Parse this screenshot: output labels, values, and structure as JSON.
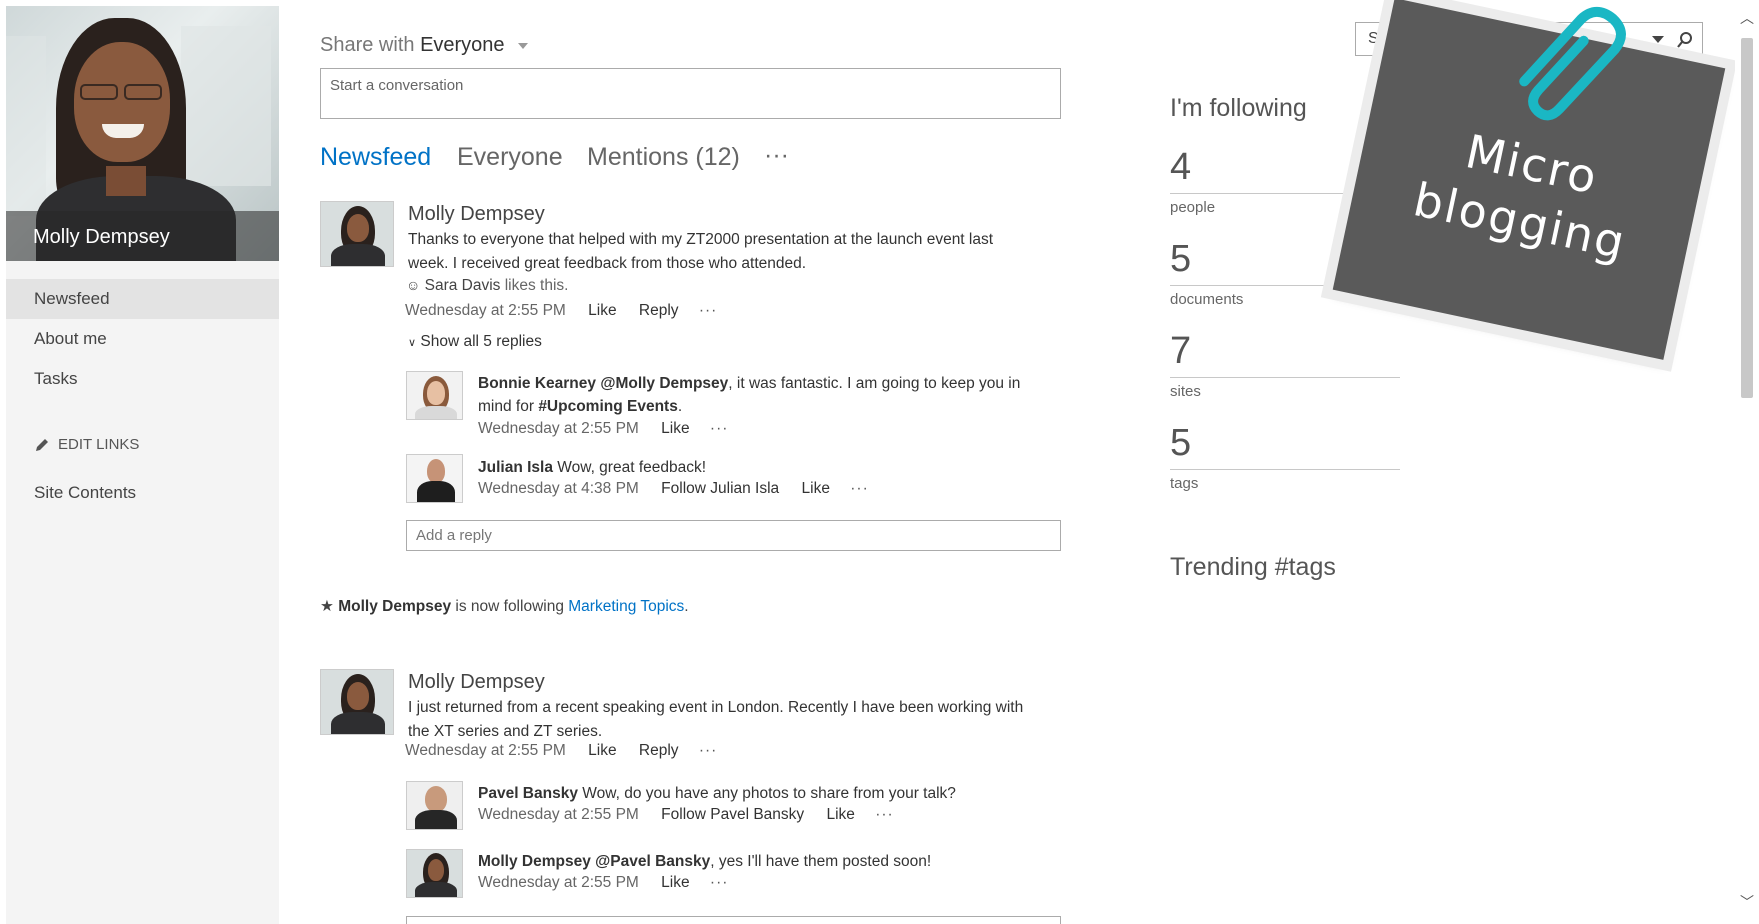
{
  "profile": {
    "name": "Molly Dempsey"
  },
  "nav": {
    "items": [
      {
        "label": "Newsfeed"
      },
      {
        "label": "About me"
      },
      {
        "label": "Tasks"
      }
    ],
    "edit_links": "EDIT LINKS",
    "site_contents": "Site Contents"
  },
  "share": {
    "prefix": "Share with",
    "audience": "Everyone",
    "placeholder": "Start a conversation"
  },
  "tabs": [
    {
      "label": "Newsfeed"
    },
    {
      "label": "Everyone"
    },
    {
      "label": "Mentions (12)"
    },
    {
      "label": "···"
    }
  ],
  "posts": [
    {
      "author": "Molly Dempsey",
      "text": "Thanks to everyone that helped with my ZT2000 presentation at the launch event last week. I received great feedback from those who attended.",
      "likes": {
        "who": "Sara Davis",
        "suffix": "likes this."
      },
      "time": "Wednesday at 2:55 PM",
      "like": "Like",
      "reply": "Reply",
      "more": "···",
      "show_replies": "Show all 5 replies",
      "replies": [
        {
          "author": "Bonnie Kearney",
          "mention": "@Molly Dempsey",
          "text_a": ", it was fantastic. I am going to keep you in mind for ",
          "hashtag": "#Upcoming Events",
          "text_b": ".",
          "time": "Wednesday at 2:55 PM",
          "like": "Like",
          "more": "···"
        },
        {
          "author": "Julian Isla",
          "text": "Wow, great feedback!",
          "time": "Wednesday at 4:38 PM",
          "follow": "Follow Julian Isla",
          "like": "Like",
          "more": "···"
        }
      ],
      "reply_placeholder": "Add a reply"
    },
    {
      "author": "Molly Dempsey",
      "text": "I just returned from a recent speaking event in London.  Recently I have been working with the XT series and ZT series.",
      "time": "Wednesday at 2:55 PM",
      "like": "Like",
      "reply": "Reply",
      "more": "···",
      "replies": [
        {
          "author": "Pavel Bansky",
          "text": "Wow, do you have any photos to share from your talk?",
          "time": "Wednesday at 2:55 PM",
          "follow": "Follow Pavel Bansky",
          "like": "Like",
          "more": "···"
        },
        {
          "author": "Molly Dempsey",
          "mention": "@Pavel Bansky",
          "text": ", yes I'll have them posted soon!",
          "time": "Wednesday at 2:55 PM",
          "like": "Like",
          "more": "···"
        }
      ]
    }
  ],
  "activity": {
    "who": "Molly Dempsey",
    "text": "is now following",
    "target": "Marketing Topics",
    "end": "."
  },
  "search": {
    "placeholder": "Search"
  },
  "following": {
    "title": "I'm following",
    "stats": [
      {
        "value": "4",
        "label": "people"
      },
      {
        "value": "5",
        "label": "documents"
      },
      {
        "value": "7",
        "label": "sites"
      },
      {
        "value": "5",
        "label": "tags"
      }
    ]
  },
  "trending": {
    "title": "Trending #tags"
  },
  "sticky_note": {
    "line1": "Micro",
    "line2": "blogging"
  },
  "colors": {
    "accent": "#0072c6",
    "sticky": "#5a5a5a",
    "clip": "#1ab7c4"
  }
}
